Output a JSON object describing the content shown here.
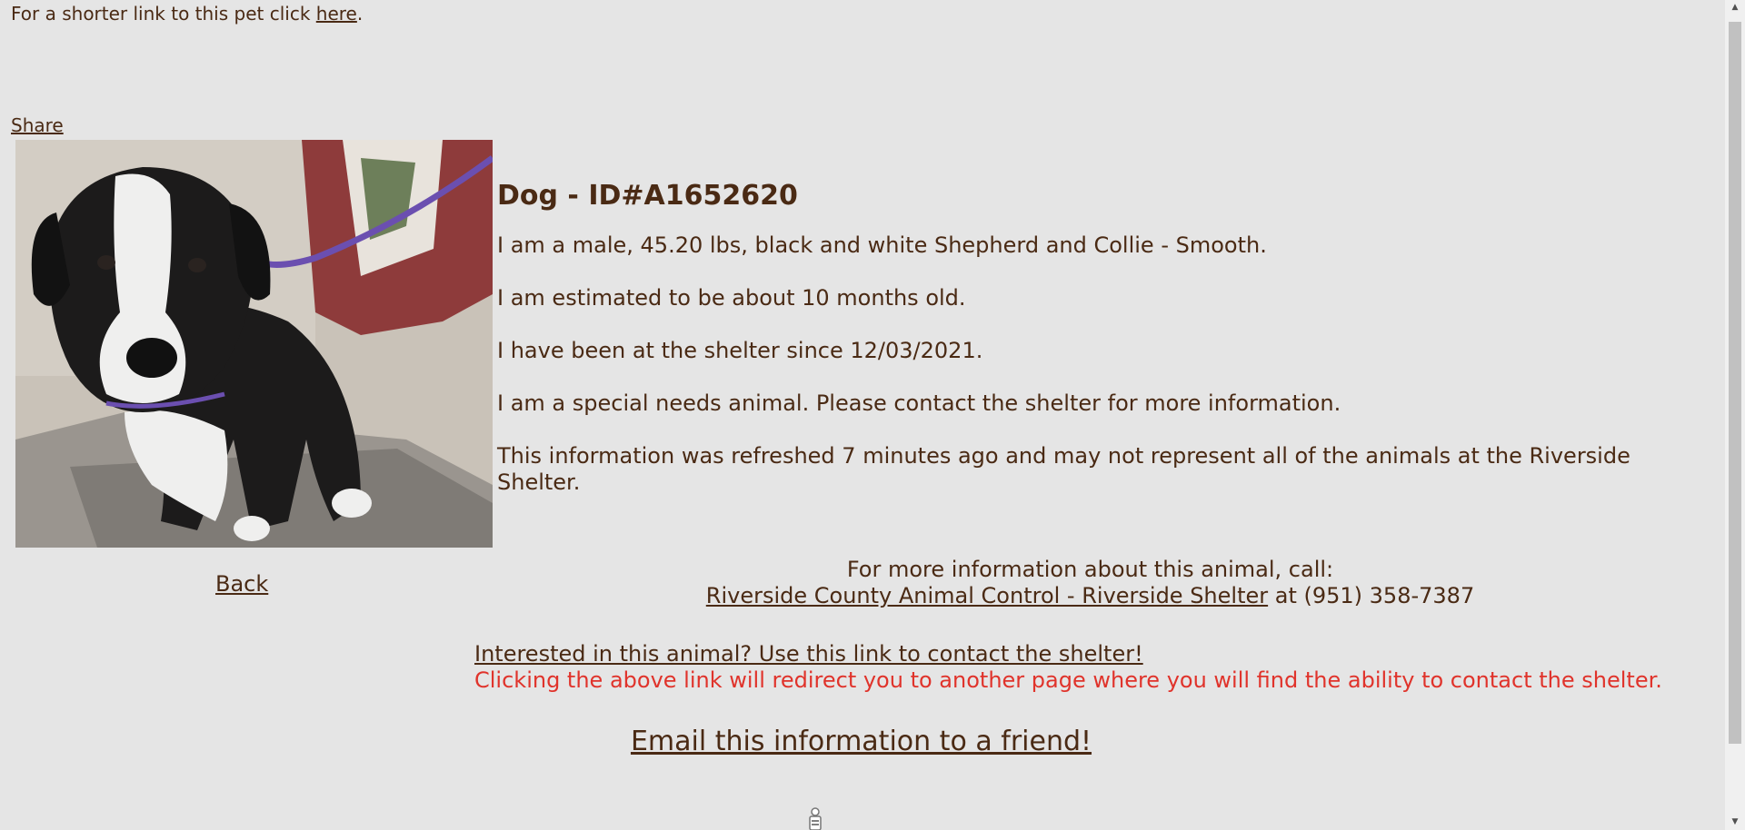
{
  "top": {
    "shorter_link_text": "For a shorter link to this pet click ",
    "here_link": "here",
    "period": "."
  },
  "share_label": "Share",
  "back_label": "Back",
  "animal": {
    "title": "Dog - ID#A1652620",
    "description": "I am a male, 45.20 lbs, black and white Shepherd and Collie - Smooth.",
    "age": "I am estimated to be about 10 months old.",
    "since": "I have been at the shelter since 12/03/2021.",
    "special_needs": "I am a special needs animal. Please contact the shelter for more information.",
    "refresh_notice": "This information was refreshed 7 minutes ago and may not represent all of the animals at the Riverside Shelter."
  },
  "contact": {
    "intro": "For more information about this animal, call:",
    "shelter_link": "Riverside County Animal Control - Riverside Shelter",
    "at": " at ",
    "phone": "(951) 358-7387"
  },
  "interested": {
    "link": "Interested in this animal? Use this link to contact the shelter!",
    "warning": "Clicking the above link will redirect you to another page where you will find the ability to contact the shelter."
  },
  "email_link": "Email this information to a friend!",
  "colors": {
    "background": "#e5e5e5",
    "text": "#4a2a14",
    "warning": "#e0332b"
  },
  "icons": {
    "loading": "spinner-icon"
  }
}
